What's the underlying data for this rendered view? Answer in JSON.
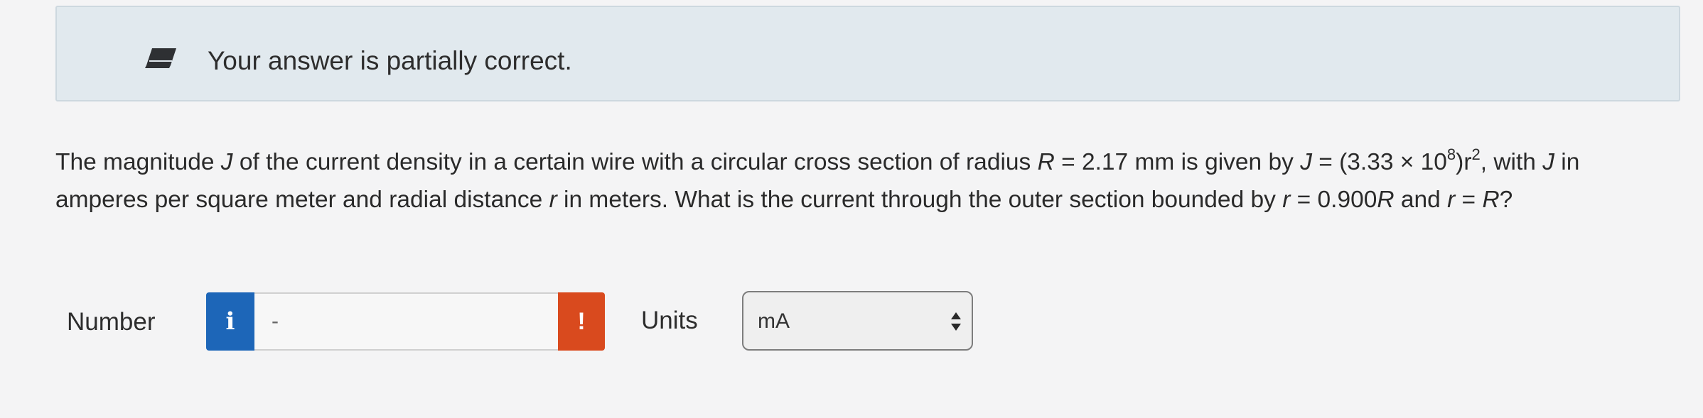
{
  "banner": {
    "icon": "pencil-eraser-icon",
    "message": "Your answer is partially correct."
  },
  "question": {
    "p1": "The magnitude ",
    "J1": "J",
    "p2": " of the current density in a certain wire with a circular cross section of radius ",
    "R1": "R",
    "p3": " = 2.17 mm is given by ",
    "J2": "J",
    "p4": " = (3.33 × 10",
    "exp1": "8",
    "p5": ")r",
    "exp2": "2",
    "p6": ", with ",
    "J3": "J",
    "p7": " in amperes per square meter and radial distance ",
    "r1": "r",
    "p8": " in meters. What is the current through the outer section bounded by ",
    "r2": "r",
    "p9": " = 0.900",
    "R2": "R",
    "p10": " and ",
    "r3": "r",
    "p11": " = ",
    "R3": "R",
    "p12": "?"
  },
  "answer": {
    "number_label": "Number",
    "info_glyph": "i",
    "number_placeholder": "-",
    "alert_glyph": "!",
    "units_label": "Units",
    "units_selected": "mA"
  },
  "colors": {
    "banner_bg": "#e1e9ee",
    "info_blue": "#1d66b8",
    "alert_orange": "#d94a1e"
  }
}
